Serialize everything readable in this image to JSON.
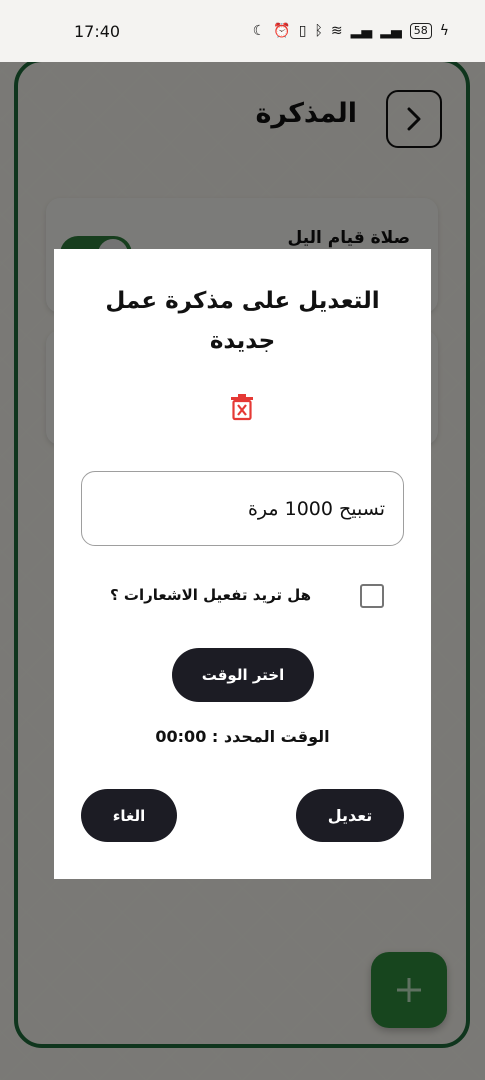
{
  "status_bar": {
    "time": "17:40",
    "battery": "58"
  },
  "header": {
    "title": "المذكرة"
  },
  "cards": [
    {
      "title": "صلاة قيام اليل"
    }
  ],
  "dialog": {
    "title": "التعديل على مذكرة عمل جديدة",
    "note_value": "تسبيح 1000 مرة",
    "notifications_label": "هل تريد تفعيل الاشعارات ؟",
    "pick_time_label": "اختر الوقت",
    "selected_time_label": "الوقت المحدد :",
    "selected_time_value": "00:00",
    "edit_label": "تعديل",
    "cancel_label": "الغاء"
  },
  "colors": {
    "accent_green": "#2e7d3c",
    "dark_button": "#1c1c24",
    "delete_red": "#e53935"
  }
}
